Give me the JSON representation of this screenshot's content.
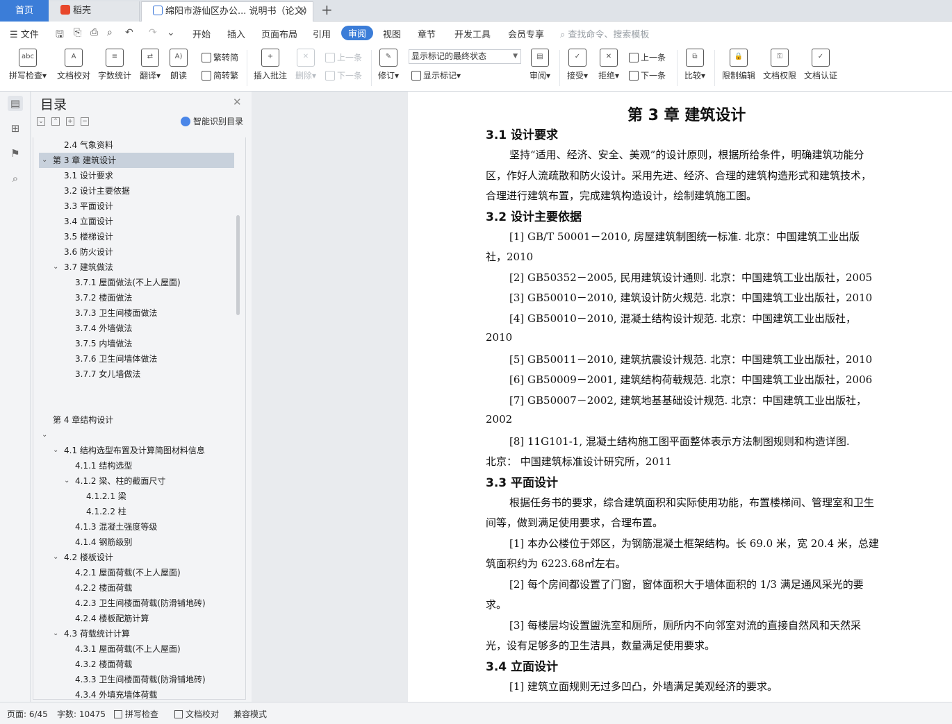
{
  "tabs": {
    "home": "首页",
    "app": "稻壳",
    "document": "绵阳市游仙区办公... 说明书（论文）",
    "close": "✕",
    "add": "+"
  },
  "menu": {
    "file": "文件",
    "items": [
      "开始",
      "插入",
      "页面布局",
      "引用",
      "审阅",
      "视图",
      "章节",
      "开发工具",
      "会员专享"
    ],
    "active": "审阅",
    "search_placeholder": "查找命令、搜索模板"
  },
  "ribbon": {
    "spellcheck": "拼写检查",
    "doc_check": "文档校对",
    "word_count": "字数统计",
    "translate": "翻译",
    "read_aloud": "朗读",
    "trad_to_simp": "繁转简",
    "simp_to_trad": "简转繁",
    "insert_comment": "插入批注",
    "delete": "删除",
    "prev_comment": "上一条",
    "next_comment": "下一条",
    "track_changes": "修订",
    "markup_state": "显示标记的最终状态",
    "show_markup": "显示标记",
    "review": "审阅",
    "accept": "接受",
    "reject": "拒绝",
    "prev_change": "上一条",
    "next_change": "下一条",
    "compare": "比较",
    "restrict_edit": "限制编辑",
    "doc_permission": "文档权限",
    "doc_certify": "文档认证"
  },
  "toc": {
    "title": "目录",
    "smart": "智能识别目录",
    "items": [
      {
        "text": "2.4  气象资料",
        "level": 2
      },
      {
        "text": "第 3 章  建筑设计",
        "level": 1,
        "expanded": true,
        "selected": true
      },
      {
        "text": "3.1  设计要求",
        "level": 2
      },
      {
        "text": "3.2  设计主要依据",
        "level": 2
      },
      {
        "text": "3.3  平面设计",
        "level": 2
      },
      {
        "text": "3.4 立面设计",
        "level": 2
      },
      {
        "text": "3.5  楼梯设计",
        "level": 2
      },
      {
        "text": "3.6  防火设计",
        "level": 2
      },
      {
        "text": "3.7  建筑做法",
        "level": 2,
        "expanded": true
      },
      {
        "text": "3.7.1  屋面做法(不上人屋面)",
        "level": 3
      },
      {
        "text": "3.7.2  楼面做法",
        "level": 3
      },
      {
        "text": "3.7.3  卫生间楼面做法",
        "level": 3
      },
      {
        "text": "3.7.4  外墙做法",
        "level": 3
      },
      {
        "text": "3.7.5  内墙做法",
        "level": 3
      },
      {
        "text": "3.7.6  卫生间墙体做法",
        "level": 3
      },
      {
        "text": "3.7.7  女儿墙做法",
        "level": 3
      },
      {
        "text": "",
        "level": 1
      },
      {
        "text": "",
        "level": 1
      },
      {
        "text": "第 4 章结构设计",
        "level": 1
      },
      {
        "text": "",
        "level": 1,
        "expanded": true
      },
      {
        "text": "4.1  结构选型布置及计算简图材料信息",
        "level": 2,
        "expanded": true
      },
      {
        "text": "4.1.1  结构选型",
        "level": 3
      },
      {
        "text": "4.1.2  梁、柱的截面尺寸",
        "level": 3,
        "expanded": true
      },
      {
        "text": "4.1.2.1 梁",
        "level": 4
      },
      {
        "text": "4.1.2.2  柱",
        "level": 4
      },
      {
        "text": "4.1.3  混凝土强度等级",
        "level": 3
      },
      {
        "text": "4.1.4  钢筋级别",
        "level": 3
      },
      {
        "text": "4.2  楼板设计",
        "level": 2,
        "expanded": true
      },
      {
        "text": "4.2.1  屋面荷载(不上人屋面)",
        "level": 3
      },
      {
        "text": "4.2.2  楼面荷载",
        "level": 3
      },
      {
        "text": "4.2.3  卫生间楼面荷载(防滑铺地砖)",
        "level": 3
      },
      {
        "text": "4.2.4  楼板配筋计算",
        "level": 3
      },
      {
        "text": "4.3 荷载统计计算",
        "level": 2,
        "expanded": true
      },
      {
        "text": "4.3.1  屋面荷载(不上人屋面)",
        "level": 3
      },
      {
        "text": "4.3.2  楼面荷载",
        "level": 3
      },
      {
        "text": "4.3.3  卫生间楼面荷载(防滑铺地砖)",
        "level": 3
      },
      {
        "text": "4.3.4  外填充墙体荷载",
        "level": 3
      }
    ]
  },
  "document": {
    "chapter_title": "第 3 章  建筑设计",
    "lines": [
      {
        "kind": "h2",
        "text": "3.1  设计要求"
      },
      {
        "kind": "p",
        "indent": true,
        "text": "坚持“适用、经济、安全、美观”的设计原则，根据所给条件，明确建筑功能分"
      },
      {
        "kind": "p",
        "text": "区，作好人流疏散和防火设计。采用先进、经济、合理的建筑构造形式和建筑技术，"
      },
      {
        "kind": "p",
        "text": "合理进行建筑布置，完成建筑构造设计，绘制建筑施工图。"
      },
      {
        "kind": "h2",
        "text": "3.2  设计主要依据"
      },
      {
        "kind": "p",
        "indent": true,
        "text": "[1]  GB/T 50001－2010,  房屋建筑制图统一标准.  北京：中国建筑工业出版"
      },
      {
        "kind": "p",
        "text": "社，2010"
      },
      {
        "kind": "p",
        "indent": true,
        "text": "[2]  GB50352－2005,  民用建筑设计通则. 北京：中国建筑工业出版社，2005"
      },
      {
        "kind": "p",
        "indent": true,
        "text": "[3]  GB50010－2010,  建筑设计防火规范.  北京：中国建筑工业出版社，2010"
      },
      {
        "kind": "p",
        "indent": true,
        "text": "[4]  GB50010－2010,  混凝土结构设计规范.  北京：中国建筑工业出版社，"
      },
      {
        "kind": "p",
        "text": "2010"
      },
      {
        "kind": "p",
        "indent": true,
        "text": "[5]  GB50011－2010,  建筑抗震设计规范. 北京：中国建筑工业出版社，2010"
      },
      {
        "kind": "p",
        "indent": true,
        "text": "[6]  GB50009－2001,  建筑结构荷载规范. 北京：中国建筑工业出版社，2006"
      },
      {
        "kind": "p",
        "indent": true,
        "text": "[7]  GB50007－2002,  建筑地基基础设计规范.  北京：中国建筑工业出版社，"
      },
      {
        "kind": "p",
        "text": "2002"
      },
      {
        "kind": "p",
        "indent": true,
        "text": "[8]  11G101-1,  混凝土结构施工图平面整体表示方法制图规则和构造详图."
      },
      {
        "kind": "p",
        "text": "北京：  中国建筑标准设计研究所，2011"
      },
      {
        "kind": "h2",
        "text": "3.3  平面设计"
      },
      {
        "kind": "p",
        "indent": true,
        "text": "根据任务书的要求，综合建筑面积和实际使用功能，布置楼梯间、管理室和卫生"
      },
      {
        "kind": "p",
        "text": "间等，做到满足使用要求，合理布置。"
      },
      {
        "kind": "p",
        "indent": true,
        "text": "[1] 本办公楼位于郊区，为钢筋混凝土框架结构。长 69.0 米，宽 20.4 米，总建"
      },
      {
        "kind": "p",
        "text": "筑面积约为 6223.68㎡左右。"
      },
      {
        "kind": "p",
        "indent": true,
        "text": "[2] 每个房间都设置了门窗，窗体面积大于墙体面积的 1/3 满足通风采光的要"
      },
      {
        "kind": "p",
        "text": "求。"
      },
      {
        "kind": "p",
        "indent": true,
        "text": "[3] 每楼层均设置盥洗室和厕所，厕所内不向邻室对流的直接自然风和天然采"
      },
      {
        "kind": "p",
        "text": "光，设有足够多的卫生洁具，数量满足使用要求。"
      },
      {
        "kind": "h2",
        "text": "3.4 立面设计"
      },
      {
        "kind": "p",
        "indent": true,
        "text": "[1] 建筑立面规则无过多凹凸，外墙满足美观经济的要求。"
      }
    ]
  },
  "status": {
    "page": "页面: 6/45",
    "words": "字数: 10475",
    "spellcheck": "拼写检查",
    "doc_check": "文档校对",
    "compat": "兼容模式"
  }
}
